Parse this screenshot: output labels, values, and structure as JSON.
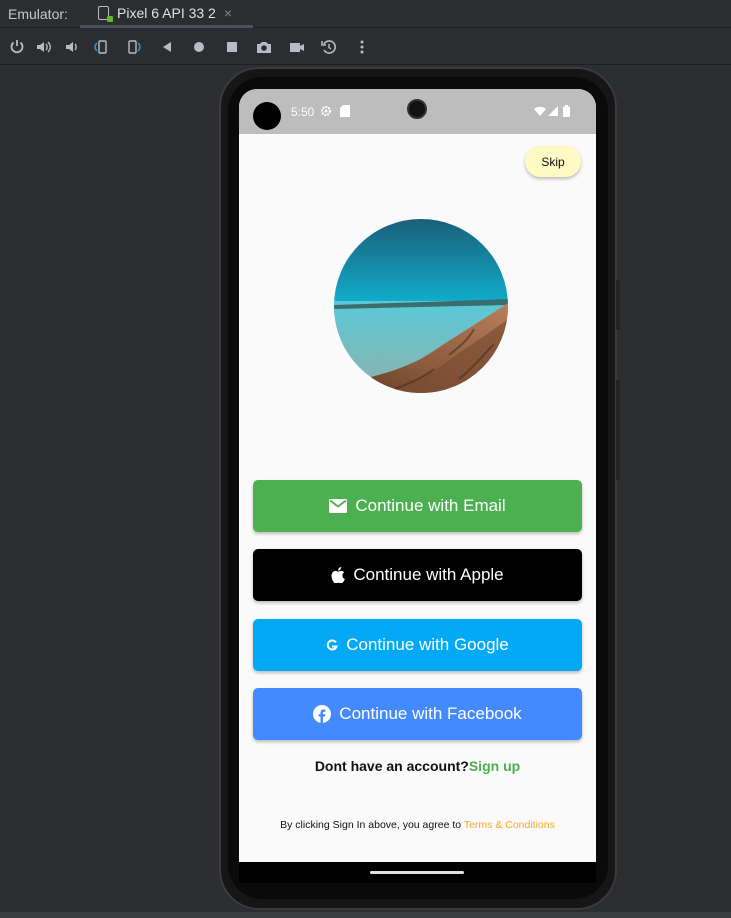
{
  "ide": {
    "emulator_label": "Emulator:",
    "tab_label": "Pixel 6 API 33 2",
    "tab_close": "×",
    "toolbar_icons": [
      "power-icon",
      "volume-up-icon",
      "volume-down-icon",
      "rotate-left-icon",
      "rotate-right-icon",
      "back-icon",
      "home-icon",
      "overview-icon",
      "screenshot-icon",
      "record-icon",
      "snapshot-icon",
      "more-icon"
    ]
  },
  "status_bar": {
    "time": "5:50",
    "icons": [
      "gear-icon",
      "sd-card-icon",
      "wifi-icon",
      "signal-icon",
      "battery-icon"
    ]
  },
  "app": {
    "skip_label": "Skip",
    "buttons": [
      {
        "label": "Continue with Email",
        "icon": "mail-icon",
        "color": "#4caf50"
      },
      {
        "label": "Continue with Apple",
        "icon": "apple-icon",
        "color": "#000000"
      },
      {
        "label": "Continue with Google",
        "icon": "google-icon",
        "color": "#03a9f4"
      },
      {
        "label": "Continue with Facebook",
        "icon": "facebook-icon",
        "color": "#448aff"
      }
    ],
    "signup_prompt": "Dont have an account?",
    "signup_link": "Sign up",
    "terms_prefix": "By clicking Sign In above, you agree to ",
    "terms_link": "Terms & Conditions"
  },
  "colors": {
    "skip_bg": "#fff9c4",
    "link_green": "#4caf50",
    "link_orange": "#f9a825",
    "status_bar_bg": "#bdbdbd"
  }
}
